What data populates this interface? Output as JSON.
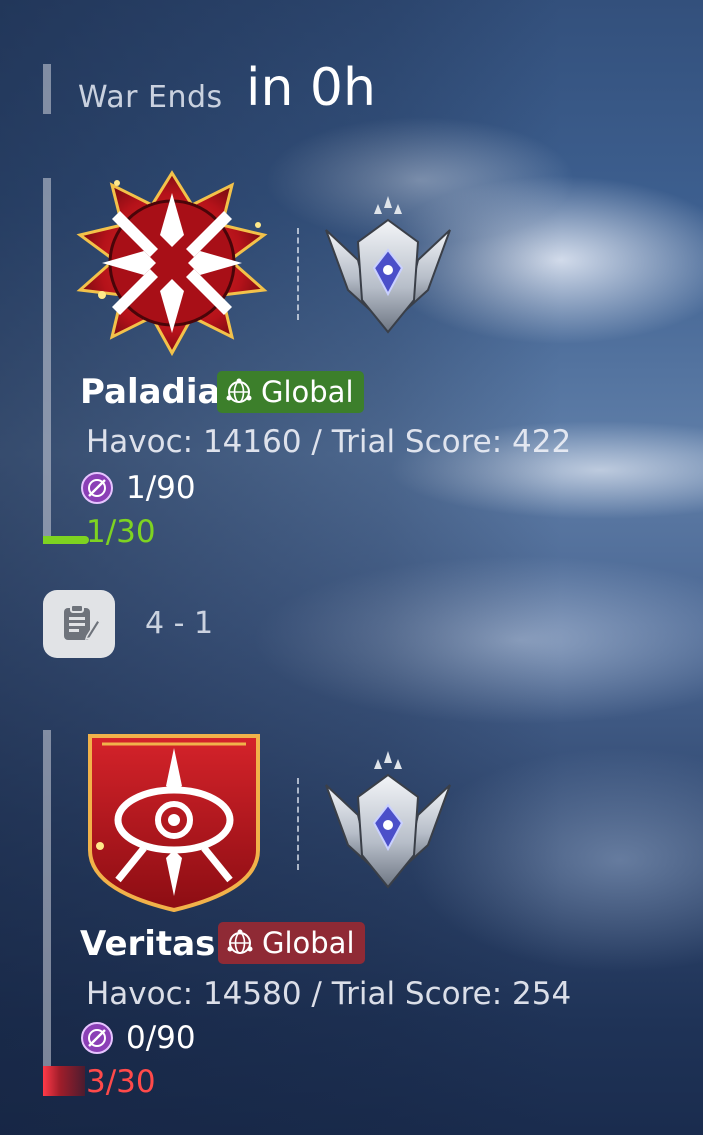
{
  "header": {
    "war_ends_label": "War Ends",
    "war_ends_time": "in 0h"
  },
  "match_score": "4 - 1",
  "guilds": [
    {
      "name": "Paladia",
      "region_badge": "Global",
      "badge_color": "#3c7f2b",
      "stats": "Havoc: 14160 / Trial Score: 422",
      "tickets": "1/90",
      "progress": "1/30",
      "progress_color": "#7ed321",
      "emblem_icon": "red-cross-crest-icon",
      "rank_icon": "silver-winged-rank-icon"
    },
    {
      "name": "Veritas",
      "region_badge": "Global",
      "badge_color": "#8f2a35",
      "stats": "Havoc: 14580 / Trial Score: 254",
      "tickets": "0/90",
      "progress": "3/30",
      "progress_color": "#ff4a4a",
      "emblem_icon": "red-eye-shield-icon",
      "rank_icon": "silver-winged-rank-icon"
    }
  ],
  "colors": {
    "accent_green": "#7ed321",
    "accent_red": "#ff4a4a"
  }
}
